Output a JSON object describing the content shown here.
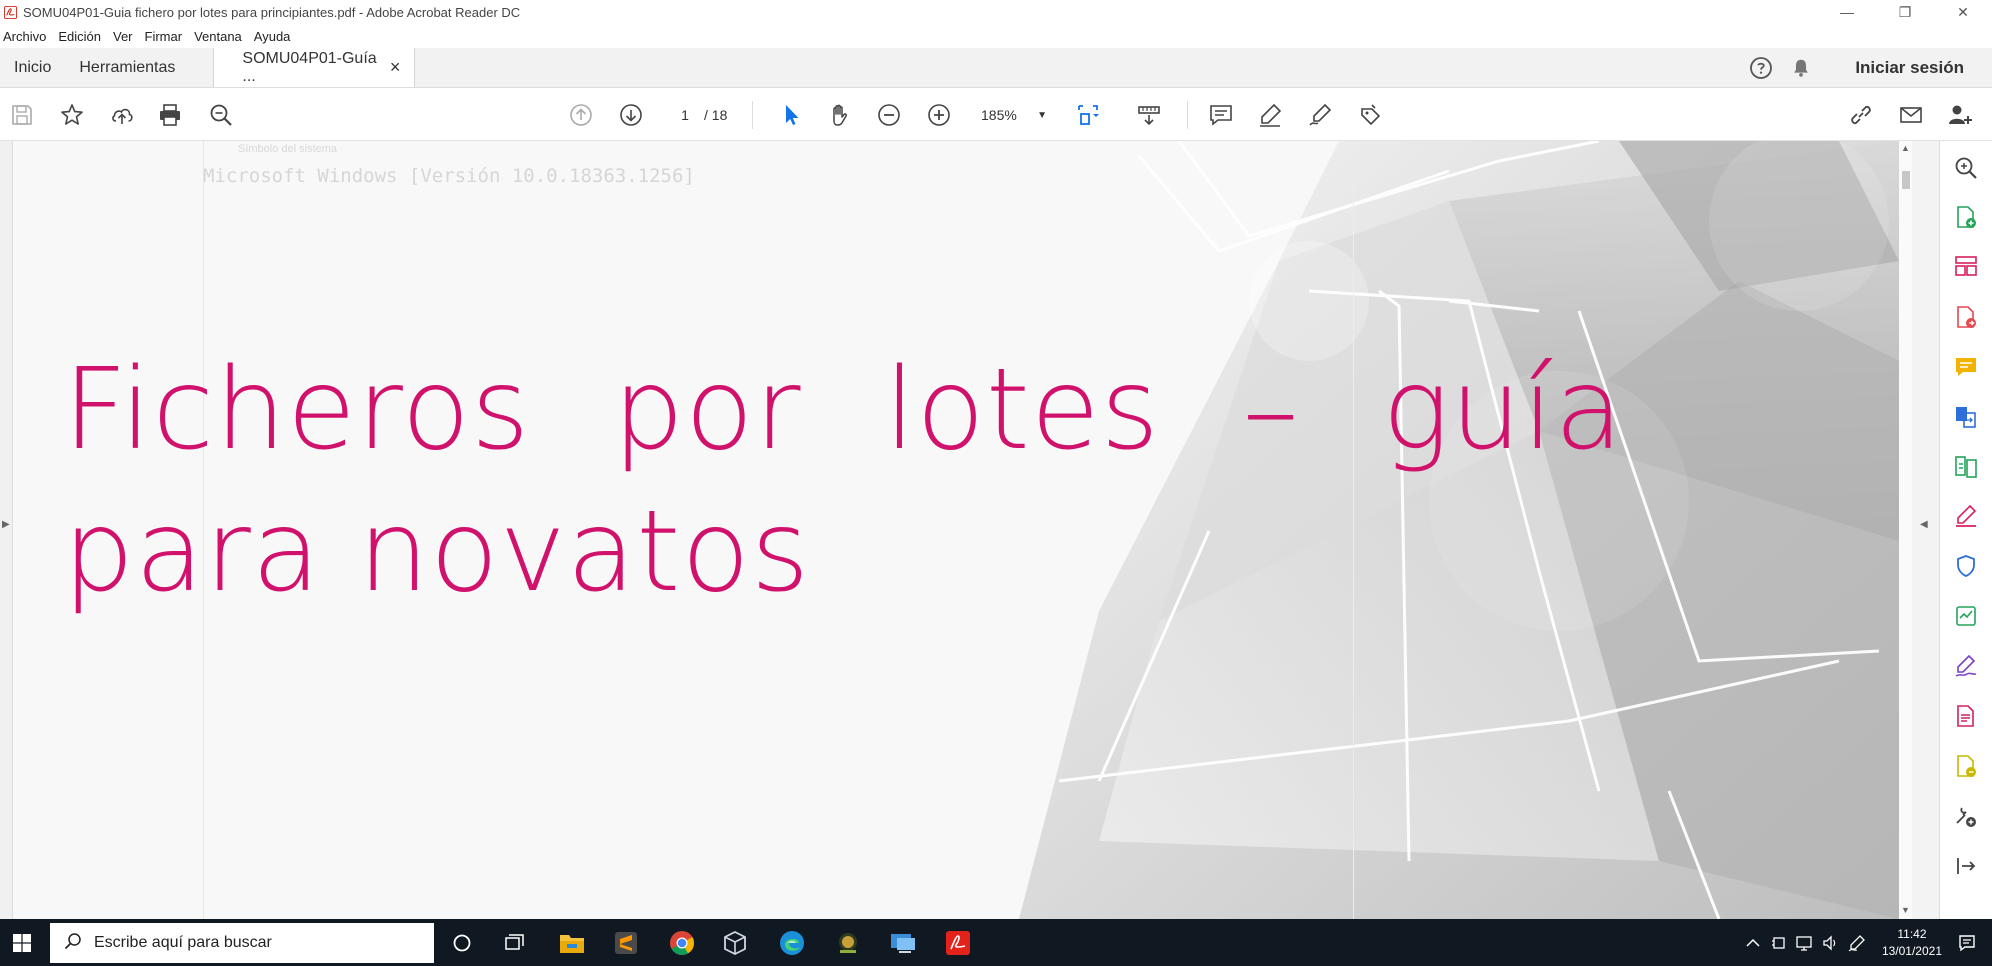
{
  "window": {
    "title": "SOMU04P01-Guia fichero por lotes para principiantes.pdf - Adobe Acrobat Reader DC",
    "minimize": "—",
    "restore": "❐",
    "close": "✕"
  },
  "menu": [
    "Archivo",
    "Edición",
    "Ver",
    "Firmar",
    "Ventana",
    "Ayuda"
  ],
  "tabs": {
    "home": "Inicio",
    "tools": "Herramientas",
    "document": "SOMU04P01-Guía ...",
    "close": "×"
  },
  "header": {
    "signin": "Iniciar sesión"
  },
  "toolbar": {
    "page_current": "1",
    "page_total": "/  18",
    "zoom": "185%"
  },
  "document": {
    "ghost_window_title": "Símbolo del sistema",
    "ghost_console_text": "Microsoft Windows [Versión 10.0.18363.1256]",
    "title_line1": "Ficheros por lotes – guía",
    "title_line2": "para novatos",
    "title_color": "#d1126c"
  },
  "taskbar": {
    "search_placeholder": "Escribe aquí para buscar",
    "time": "11:42",
    "date": "13/01/2021"
  },
  "colors": {
    "accent_blue": "#1473e6",
    "acrobat_red": "#e3231b",
    "taskbar_bg": "#101821"
  }
}
